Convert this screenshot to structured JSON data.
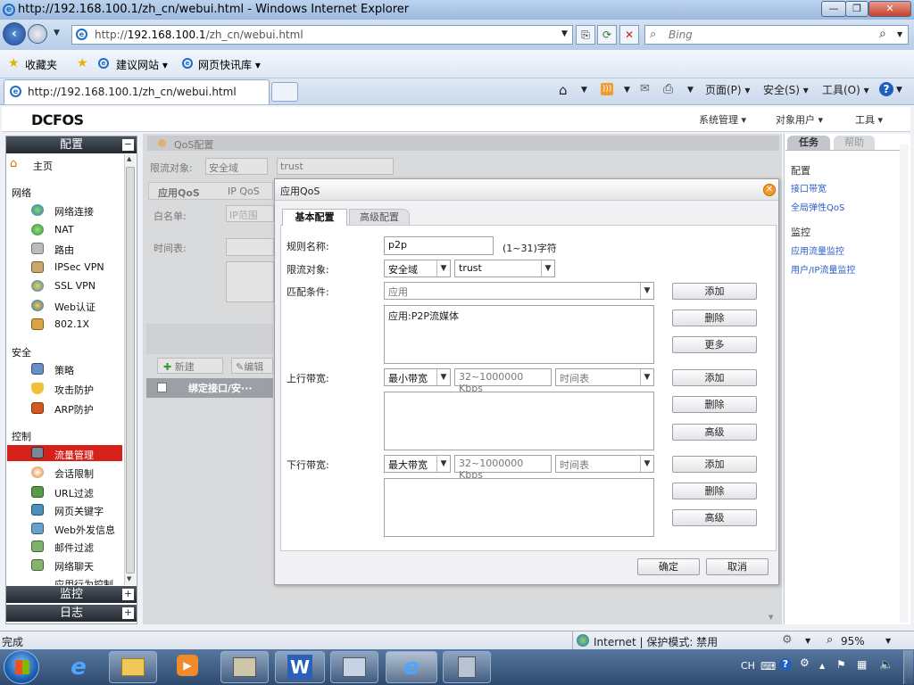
{
  "window": {
    "title": "http://192.168.100.1/zh_cn/webui.html - Windows Internet Explorer",
    "minimize": "—",
    "restore": "❐",
    "close": "✕"
  },
  "address": {
    "prefix": "http://",
    "host": "192.168.100.1",
    "path": "/zh_cn/webui.html",
    "search_placeholder": "Bing"
  },
  "favorites": {
    "favorites_label": "收藏夹",
    "suggested_sites": "建议网站 ▾",
    "web_slice": "网页快讯库 ▾"
  },
  "tabs": {
    "active_title": "http://192.168.100.1/zh_cn/webui.html"
  },
  "commands": {
    "page": "页面(P) ▾",
    "safety": "安全(S) ▾",
    "tools": "工具(O) ▾",
    "help": "?"
  },
  "app": {
    "logo": "DCFOS",
    "menu": [
      "系统管理 ▾",
      "对象用户 ▾",
      "工具 ▾"
    ]
  },
  "sidebar": {
    "config_header": "配置",
    "home": "主页",
    "sections": {
      "network": "网络",
      "security": "安全",
      "control": "控制"
    },
    "network_items": [
      "网络连接",
      "NAT",
      "路由",
      "IPSec VPN",
      "SSL VPN",
      "Web认证",
      "802.1X"
    ],
    "security_items": [
      "策略",
      "攻击防护",
      "ARP防护"
    ],
    "control_items": [
      "流量管理",
      "会话限制",
      "URL过滤",
      "网页关键字",
      "Web外发信息",
      "邮件过滤",
      "网络聊天",
      "应用行为控制"
    ],
    "monitor_header": "监控",
    "log_header": "日志",
    "expand": "+",
    "collapse": "−"
  },
  "background": {
    "page_title": "QoS配置",
    "limit_target_label": "限流对象:",
    "limit_zone": "安全域",
    "limit_trust": "trust",
    "tab_app_qos": "应用QoS",
    "tab_ip_qos": "IP QoS",
    "whitelist_label": "白名单:",
    "ip_range_placeholder": "IP范围",
    "schedule_label": "时间表:",
    "new_button": "新建",
    "edit_button": "编辑",
    "column_bind": "绑定接口/安···"
  },
  "right_panel": {
    "tab_tasks": "任务",
    "tab_help": "帮助",
    "config_header": "配置",
    "links_config": [
      "接口带宽",
      "全局弹性QoS"
    ],
    "monitor_header": "监控",
    "links_monitor": [
      "应用流量监控",
      "用户/IP流量监控"
    ]
  },
  "dialog": {
    "title": "应用QoS",
    "tab_basic": "基本配置",
    "tab_advanced": "高级配置",
    "rule_name_label": "规则名称:",
    "rule_name_value": "p2p",
    "rule_name_hint": "(1~31)字符",
    "limit_target_label": "限流对象:",
    "limit_zone": "安全域",
    "limit_trust": "trust",
    "match_label": "匹配条件:",
    "match_placeholder": "应用",
    "match_list": [
      "应用:P2P流媒体"
    ],
    "up_label": "上行带宽:",
    "up_mode": "最小带宽",
    "up_rate_placeholder": "32~1000000 Kbps",
    "up_schedule_placeholder": "时间表",
    "down_label": "下行带宽:",
    "down_mode": "最大带宽",
    "down_rate_placeholder": "32~1000000 Kbps",
    "down_schedule_placeholder": "时间表",
    "btn_add": "添加",
    "btn_delete": "删除",
    "btn_more": "更多",
    "btn_advanced": "高级",
    "btn_ok": "确定",
    "btn_cancel": "取消"
  },
  "statusbar": {
    "left": "完成",
    "zone": "Internet | 保护模式: 禁用",
    "zoom": "95%"
  },
  "taskbar": {
    "ime": "CH"
  }
}
